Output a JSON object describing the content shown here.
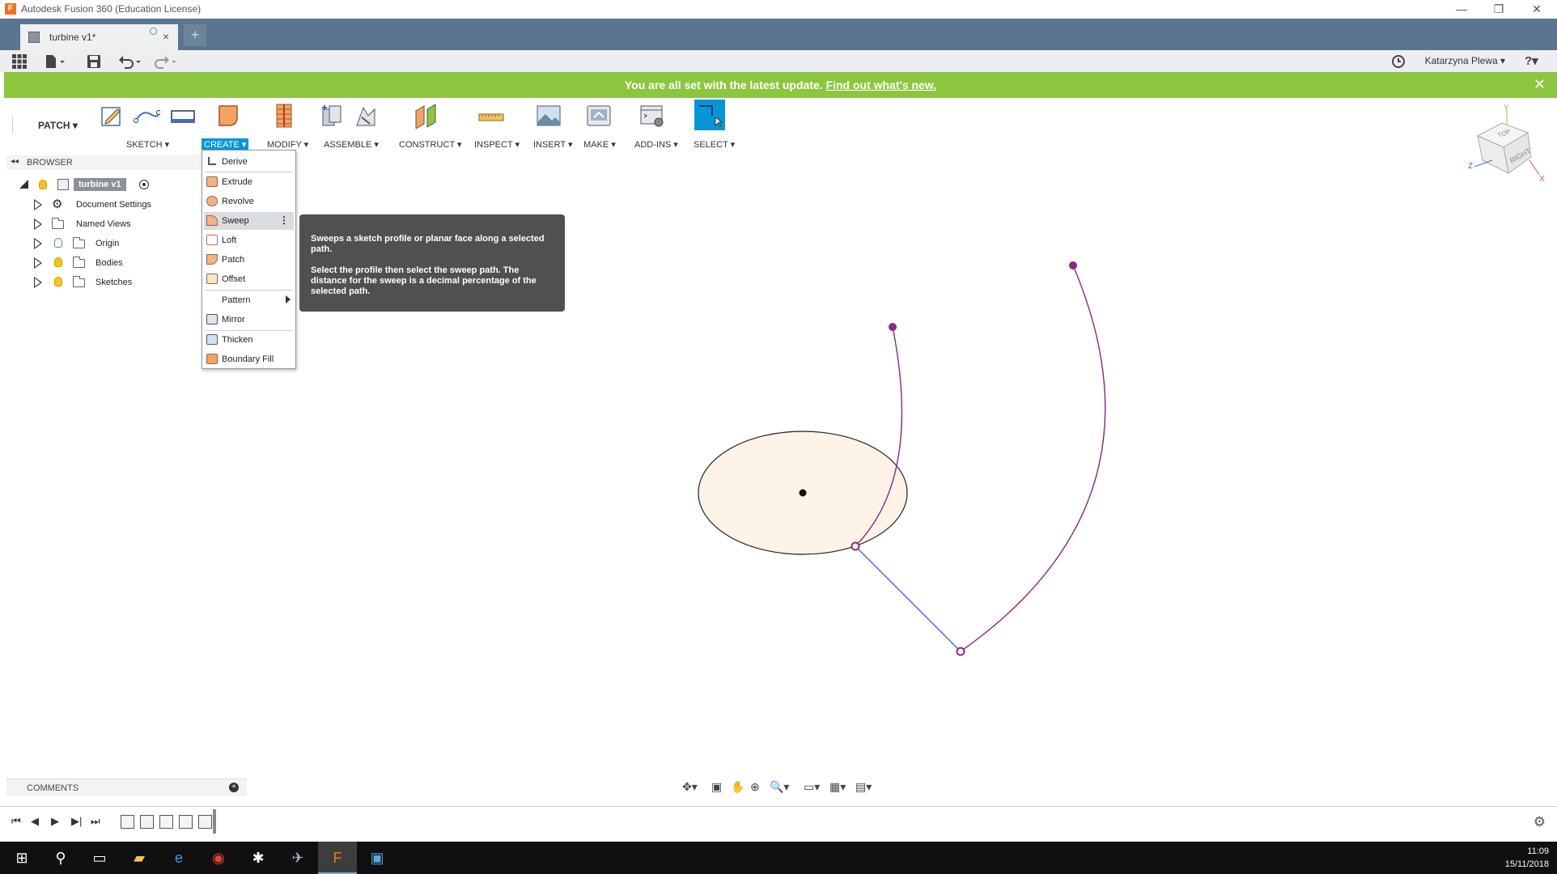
{
  "window": {
    "title": "Autodesk Fusion 360 (Education License)",
    "minimize": "—",
    "restore": "❐",
    "close": "✕"
  },
  "tab": {
    "document_name": "turbine v1*",
    "close": "×",
    "new_tab": "+"
  },
  "quickbar": {
    "user_name": "Katarzyna Plewa ▾",
    "help": "?▾"
  },
  "banner": {
    "message": "You are all set with the latest update.",
    "link": "Find out what's new.",
    "close": "✕"
  },
  "ribbon": {
    "workspace": "PATCH ▾",
    "groups": {
      "sketch": "SKETCH ▾",
      "create": "CREATE ▾",
      "modify": "MODIFY ▾",
      "assemble": "ASSEMBLE ▾",
      "construct": "CONSTRUCT ▾",
      "inspect": "INSPECT ▾",
      "insert": "INSERT ▾",
      "make": "MAKE ▾",
      "addins": "ADD-INS ▾",
      "select": "SELECT ▾"
    }
  },
  "browser": {
    "title": "BROWSER",
    "collapse": "◂◂",
    "root": "turbine v1",
    "items": [
      {
        "label": "Document Settings"
      },
      {
        "label": "Named Views"
      },
      {
        "label": "Origin"
      },
      {
        "label": "Bodies"
      },
      {
        "label": "Sketches"
      }
    ]
  },
  "create_menu": {
    "items": [
      {
        "label": "Derive"
      },
      {
        "label": "Extrude"
      },
      {
        "label": "Revolve"
      },
      {
        "label": "Sweep",
        "more": "⋮"
      },
      {
        "label": "Loft"
      },
      {
        "label": "Patch"
      },
      {
        "label": "Offset"
      },
      {
        "label": "Pattern"
      },
      {
        "label": "Mirror"
      },
      {
        "label": "Thicken"
      },
      {
        "label": "Boundary Fill"
      }
    ]
  },
  "tooltip": {
    "line1": "Sweeps a sketch profile or planar face along a selected path.",
    "line2": "Select the profile then select the sweep path. The distance for the sweep is a decimal percentage of the selected path."
  },
  "comments": {
    "label": "COMMENTS",
    "add": "+"
  },
  "viewcube": {
    "top": "TOP",
    "right": "RIGHT",
    "axis_x": "X",
    "axis_y": "Y",
    "axis_z": "Z"
  },
  "taskbar": {
    "time": "11:09",
    "date": "15/11/2018"
  },
  "colors": {
    "banner": "#8cc63f",
    "tabbar": "#5a758f",
    "accent": "#0696d7",
    "path": "#8b2a7f",
    "line": "#3e6fcf",
    "profile_fill": "#fdf3e7"
  }
}
